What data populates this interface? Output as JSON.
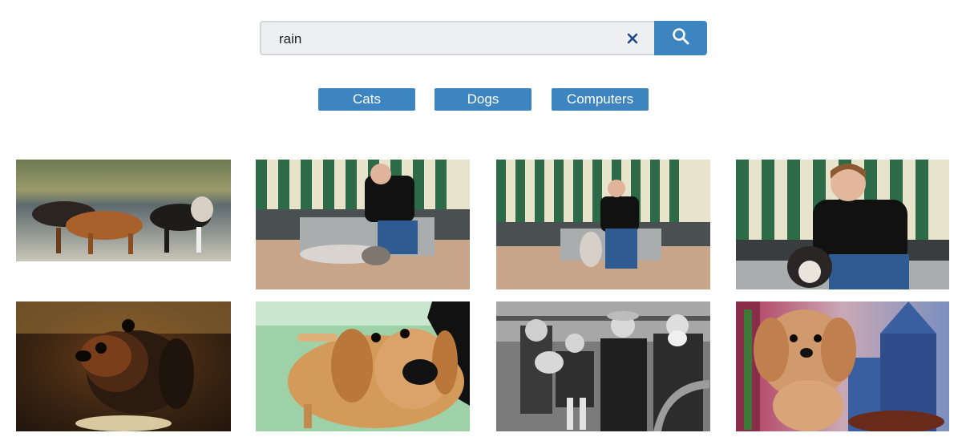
{
  "search": {
    "value": "rain",
    "clear_icon": "close-icon",
    "submit_icon": "search-icon"
  },
  "categories": [
    "Cats",
    "Dogs",
    "Computers"
  ],
  "colors": {
    "accent": "#3c85c0",
    "search_bg": "#eeeff1",
    "border": "#d3d6da"
  },
  "images": [
    {
      "subject": "group-of-dogs-on-beach"
    },
    {
      "subject": "woman-petting-husky-under-striped-awning"
    },
    {
      "subject": "woman-sitting-with-husky-under-striped-awning"
    },
    {
      "subject": "smiling-woman-with-husky-close-up"
    },
    {
      "subject": "dachshund-portrait"
    },
    {
      "subject": "golden-dog-close-up"
    },
    {
      "subject": "vintage-black-and-white-group-photo-with-dog"
    },
    {
      "subject": "fluffy-dog-with-castle-background"
    }
  ]
}
